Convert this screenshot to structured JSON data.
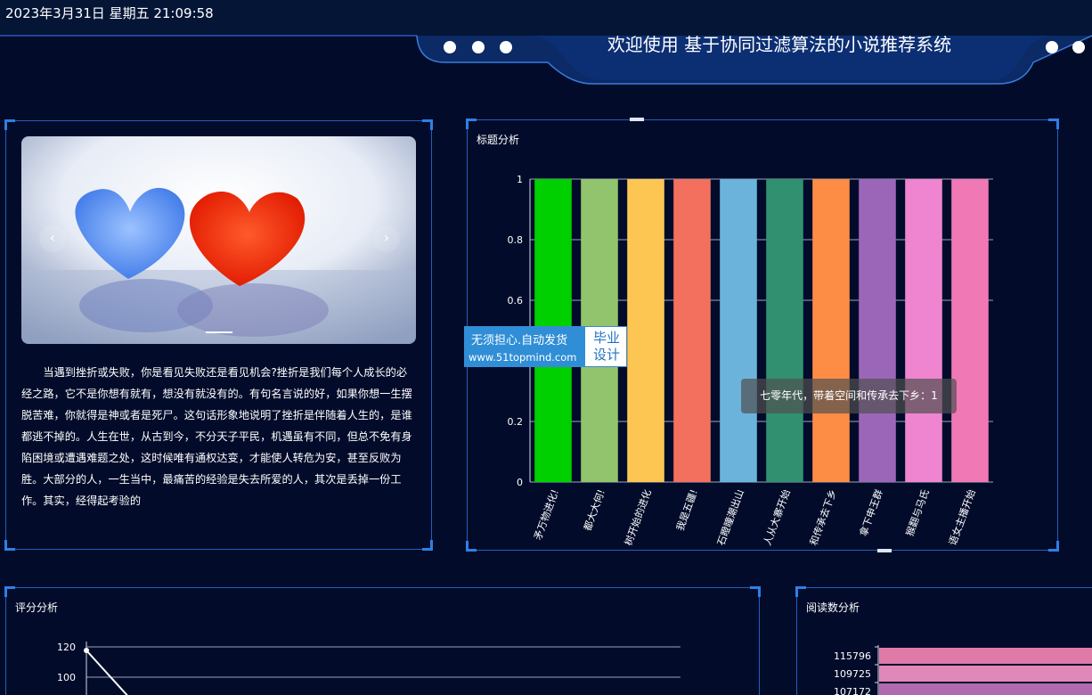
{
  "header": {
    "datetime": "2023年3月31日 星期五 21:09:58",
    "title": "欢迎使用 基于协同过滤算法的小说推荐系统"
  },
  "intro_panel": {
    "carousel": {
      "prev_icon": "‹",
      "next_icon": "›"
    },
    "text": "当遇到挫折或失败，你是看见失败还是看见机会?挫折是我们每个人成长的必经之路，它不是你想有就有，想没有就没有的。有句名言说的好，如果你想一生摆脱苦难，你就得是神或者是死尸。这句话形象地说明了挫折是伴随着人生的，是谁都逃不掉的。人生在世，从古到今，不分天子平民，机遇虽有不同，但总不免有身陷困境或遭遇难题之处，这时候唯有通权达变，才能使人转危为安，甚至反败为胜。大部分的人，一生当中，最痛苦的经验是失去所爱的人，其次是丢掉一份工作。其实，经得起考验的"
  },
  "watermark": {
    "line1": "无须担心.自动发货",
    "line2": "www.51topmind.com",
    "badge": "毕业设计"
  },
  "title_chart": {
    "title": "标题分析",
    "tooltip": "七零年代，带着空间和传承去下乡：1"
  },
  "score_chart": {
    "title": "评分分析"
  },
  "read_chart": {
    "title": "阅读数分析"
  },
  "chart_data": [
    {
      "type": "bar",
      "title": "标题分析",
      "categories": [
        "矛万物进化!",
        "都大大何!",
        "树开始的进化",
        "我是五疆!",
        "石瞪瞳潮出山",
        "人从大寨开始",
        "和传承去下乡",
        "拿下申王群",
        "猴翻与马氏",
        "语女主播开始"
      ],
      "values": [
        1,
        1,
        1,
        1,
        1,
        1,
        1,
        1,
        1,
        1
      ],
      "yticks": [
        "0",
        "0.2",
        "0.6",
        "0.8",
        "1"
      ],
      "ylim": [
        0,
        1
      ],
      "colors": [
        "#00d000",
        "#91c46c",
        "#fdc653",
        "#f4705e",
        "#6cb3dc",
        "#319070",
        "#fd8c45",
        "#9b66b8",
        "#ef84d0",
        "#f079b5"
      ]
    },
    {
      "type": "line",
      "title": "评分分析",
      "yticks": [
        "120",
        "100"
      ],
      "values": [
        120
      ]
    },
    {
      "type": "bar",
      "title": "阅读数分析",
      "categories": [
        "115796",
        "109725",
        "107172"
      ],
      "values": [
        115796,
        109725,
        107172
      ],
      "colors": [
        "#e07aa8",
        "#e088b8",
        "#b06ab0"
      ]
    }
  ]
}
